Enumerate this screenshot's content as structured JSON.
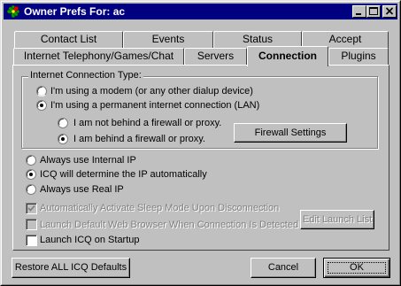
{
  "window": {
    "title": "Owner Prefs For: ac",
    "buttons": [
      "minimize",
      "maximize",
      "close"
    ]
  },
  "tabs": {
    "row1": [
      "Contact List",
      "Events",
      "Status",
      "Accept"
    ],
    "row2": [
      "Internet Telephony/Games/Chat",
      "Servers",
      "Connection",
      "Plugins"
    ],
    "active": "Connection"
  },
  "connection_type": {
    "label": "Internet Connection Type:",
    "options": [
      {
        "label": "I'm using a modem (or any other dialup device)",
        "checked": false
      },
      {
        "label": "I'm using a permanent internet connection (LAN)",
        "checked": true
      }
    ],
    "firewall_options": [
      {
        "label": "I am not behind a firewall or proxy.",
        "checked": false
      },
      {
        "label": "I am behind a firewall or proxy.",
        "checked": true
      }
    ],
    "firewall_button": "Firewall Settings"
  },
  "ip_options": [
    {
      "label": "Always use Internal IP",
      "checked": false
    },
    {
      "label": "ICQ will determine the IP automatically",
      "checked": true
    },
    {
      "label": "Always use Real IP",
      "checked": false
    }
  ],
  "checkboxes": [
    {
      "label": "Automatically Activate Sleep Mode Upon Disconnection",
      "checked": true,
      "enabled": false
    },
    {
      "label": "Launch Default Web Browser When Connection Is Detected",
      "checked": false,
      "enabled": false
    },
    {
      "label": "Launch ICQ on Startup",
      "checked": false,
      "enabled": true
    }
  ],
  "edit_launch_button": "Edit Launch List",
  "footer": {
    "restore_label": "Restore ALL ICQ Defaults",
    "cancel_label": "Cancel",
    "ok_label": "OK"
  }
}
